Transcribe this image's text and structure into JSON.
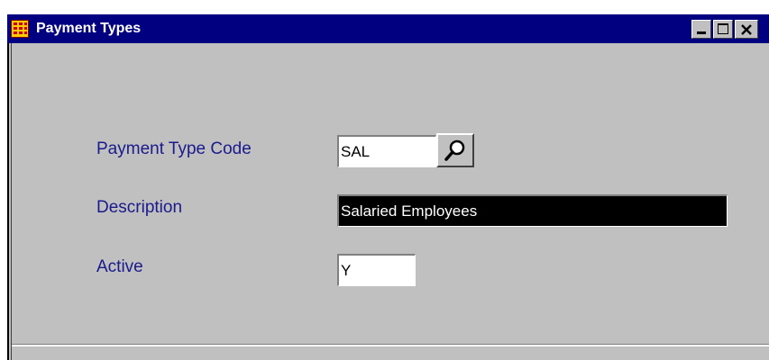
{
  "window": {
    "title": "Payment Types",
    "app_icon": "table-grid-icon",
    "controls": {
      "minimize": "minimize-icon",
      "maximize": "maximize-icon",
      "close": "close-icon"
    }
  },
  "form": {
    "payment_type_code": {
      "label": "Payment Type Code",
      "value": "SAL",
      "lookup_icon": "magnifier-icon"
    },
    "description": {
      "label": "Description",
      "value": "Salaried Employees"
    },
    "active": {
      "label": "Active",
      "value": "Y"
    }
  },
  "colors": {
    "titlebar": "#000080",
    "window_face": "#c0c0c0",
    "label_text": "#1a1a8c",
    "selection_bg": "#000000"
  }
}
